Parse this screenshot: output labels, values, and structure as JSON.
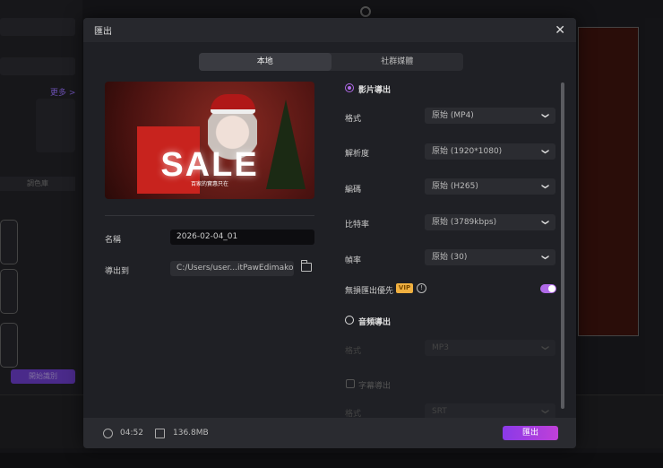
{
  "background": {
    "more_link": "更多 >",
    "color_library": "調色庫",
    "recognize_button": "開始識別"
  },
  "dialog": {
    "title": "匯出",
    "tabs": [
      {
        "label": "本地",
        "active": true
      },
      {
        "label": "社群媒體",
        "active": false
      }
    ],
    "preview": {
      "headline": "SALE",
      "subtitle": "百家的實惠只在"
    },
    "name_label": "名稱",
    "name_value": "2026-02-04_01",
    "export_to_label": "導出到",
    "export_path": "C:/Users/user...itPawEdimakor",
    "video_export": {
      "label": "影片導出",
      "selected": true,
      "fields": [
        {
          "label": "格式",
          "value": "原始 (MP4)"
        },
        {
          "label": "解析度",
          "value": "原始 (1920*1080)"
        },
        {
          "label": "編碼",
          "value": "原始 (H265)"
        },
        {
          "label": "比特率",
          "value": "原始 (3789kbps)"
        },
        {
          "label": "幀率",
          "value": "原始 (30)"
        }
      ],
      "lossless_label": "無損匯出優先",
      "vip_badge": "VIP",
      "lossless_on": true
    },
    "audio_export": {
      "label": "音頻導出",
      "selected": false,
      "format_label": "格式",
      "format_value": "MP3"
    },
    "subtitle_export": {
      "label": "字幕導出",
      "checked": false,
      "format_label": "格式",
      "format_value": "SRT"
    },
    "footer": {
      "duration": "04:52",
      "size": "136.8MB",
      "export_button": "匯出"
    },
    "accent_color": "#b06ae8"
  }
}
